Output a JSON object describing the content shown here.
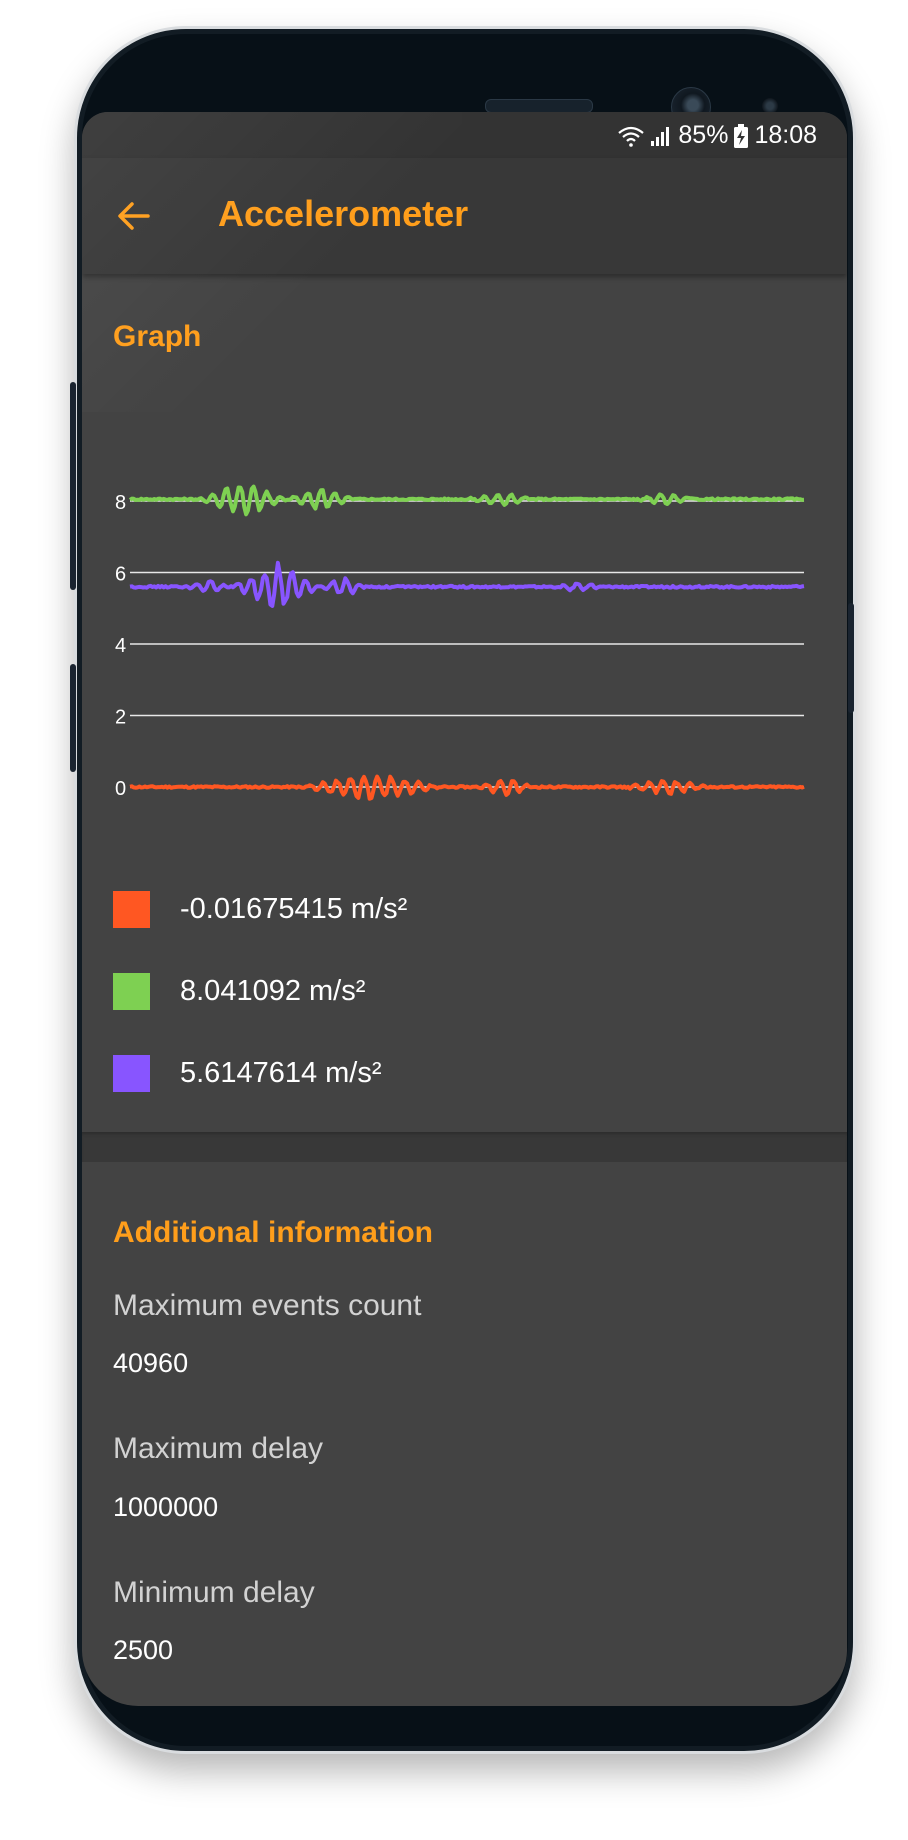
{
  "status_bar": {
    "battery": "85%",
    "time": "18:08"
  },
  "app_bar": {
    "title": "Accelerometer",
    "back_icon": "arrow-left-icon"
  },
  "graph": {
    "title": "Graph"
  },
  "chart_data": {
    "type": "line",
    "yticks": [
      "0",
      "2",
      "4",
      "6",
      "8"
    ],
    "ylim": [
      -0.8,
      9.5
    ],
    "grid": true,
    "series": [
      {
        "color": "#ff5722",
        "baseline": 0.0,
        "bursts": [
          [
            30,
            56,
            0.45
          ],
          [
            62,
            72,
            0.3
          ],
          [
            88,
            104,
            0.25
          ]
        ]
      },
      {
        "color": "#7ed052",
        "baseline": 8.05,
        "bursts": [
          [
            12,
            28,
            0.55
          ],
          [
            28,
            40,
            0.35
          ],
          [
            60,
            72,
            0.2
          ],
          [
            90,
            100,
            0.2
          ]
        ]
      },
      {
        "color": "#8855ff",
        "baseline": 5.6,
        "bursts": [
          [
            10,
            18,
            0.2
          ],
          [
            18,
            34,
            0.75
          ],
          [
            34,
            42,
            0.3
          ],
          [
            76,
            84,
            0.15
          ]
        ]
      }
    ]
  },
  "legend": [
    {
      "color": "#ff5722",
      "label": "-0.01675415 m/s²"
    },
    {
      "color": "#7ed052",
      "label": "8.041092 m/s²"
    },
    {
      "color": "#8855ff",
      "label": "5.6147614 m/s²"
    }
  ],
  "additional": {
    "title": "Additional information",
    "items": [
      {
        "label": "Maximum events count",
        "value": "40960"
      },
      {
        "label": "Maximum delay",
        "value": "1000000"
      },
      {
        "label": "Minimum delay",
        "value": "2500"
      }
    ]
  },
  "colors": {
    "accent": "#ff9e1b",
    "background": "#434343",
    "bar": "#383838"
  }
}
